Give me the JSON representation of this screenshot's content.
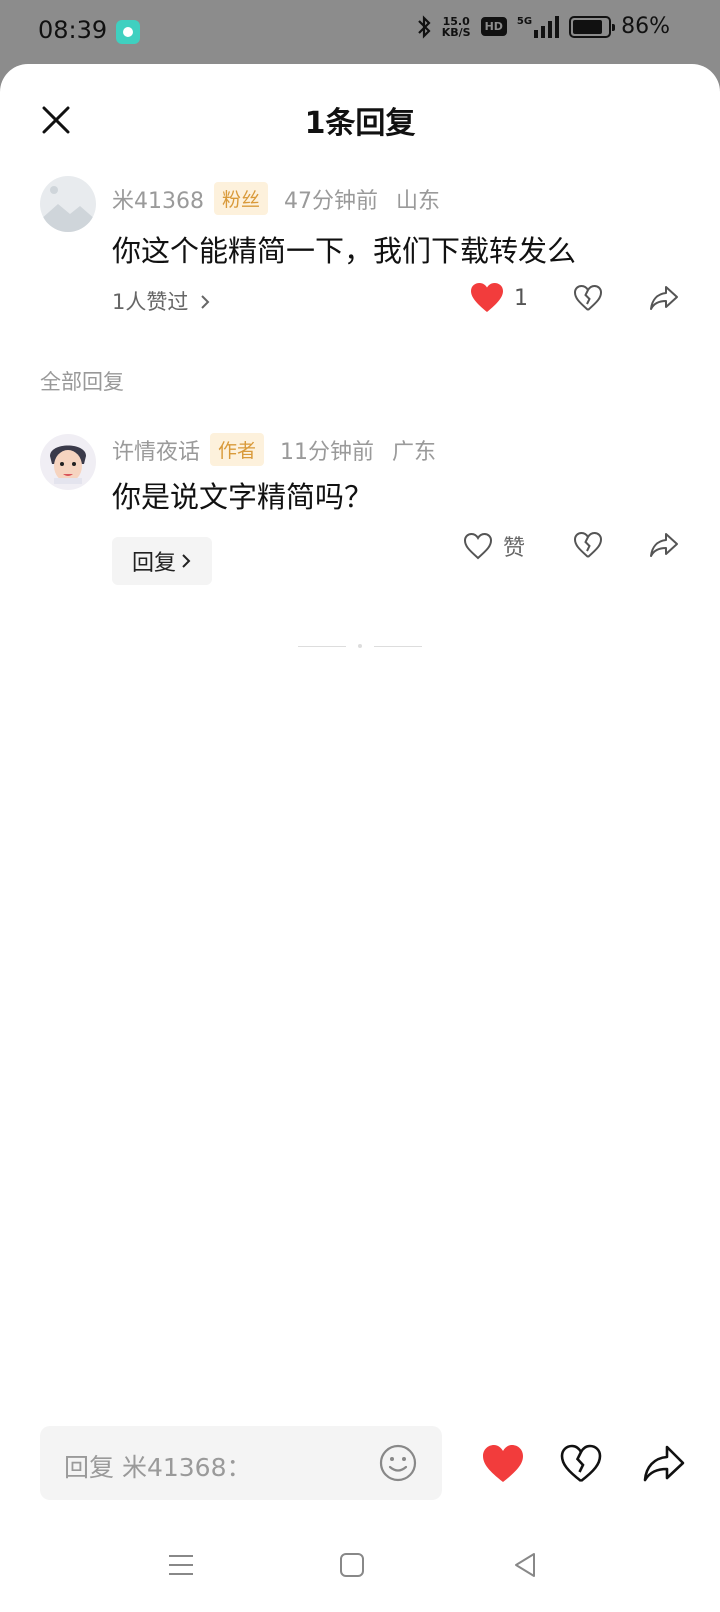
{
  "status_bar": {
    "time": "08:39",
    "net_speed_value": "15.0",
    "net_speed_unit": "KB/S",
    "hd_label": "HD",
    "network": "5G",
    "battery": "86%",
    "battery_level": 0.86
  },
  "sheet": {
    "title": "1条回复"
  },
  "comment": {
    "username": "米41368",
    "badge": "粉丝",
    "time": "47分钟前",
    "location": "山东",
    "text": "你这个能精简一下，我们下载转发么",
    "likes_link": "1人赞过",
    "like_count": "1"
  },
  "section_label": "全部回复",
  "reply": {
    "username": "许情夜话",
    "badge": "作者",
    "time": "11分钟前",
    "location": "广东",
    "text": "你是说文字精简吗？",
    "reply_button": "回复",
    "like_label": "赞"
  },
  "input": {
    "placeholder": "回复 米41368："
  },
  "colors": {
    "like_red": "#f23c3c",
    "badge_bg": "#fdf1dc",
    "badge_text": "#d99a3a"
  }
}
